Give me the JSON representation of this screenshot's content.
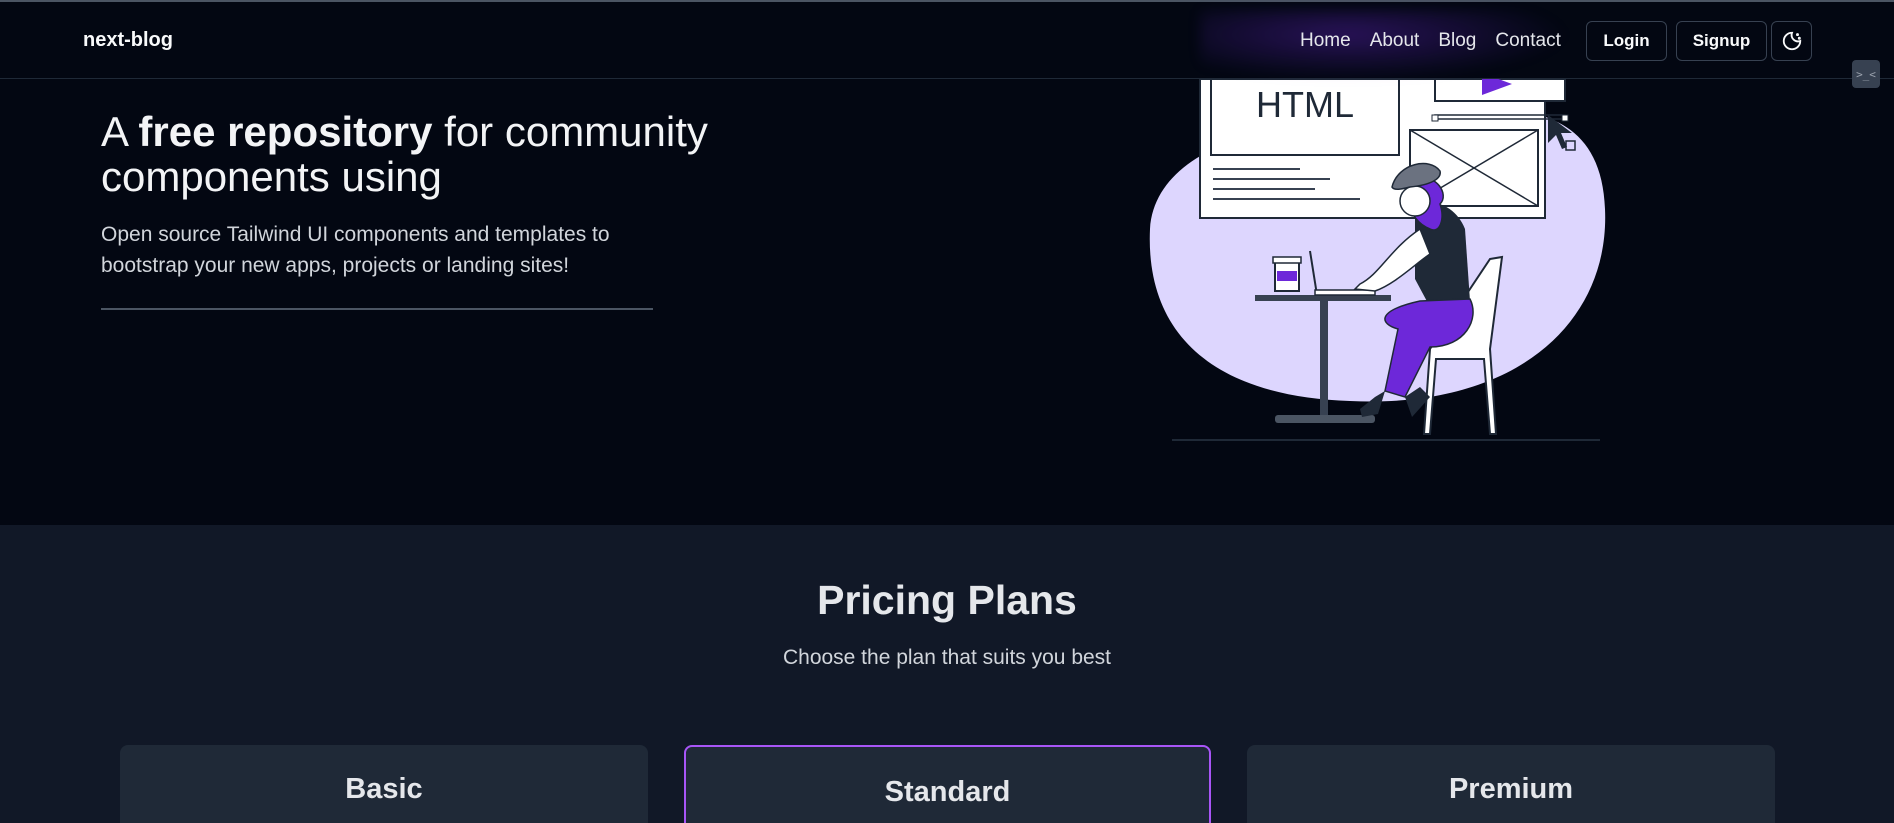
{
  "header": {
    "brand": "next-blog",
    "nav": [
      "Home",
      "About",
      "Blog",
      "Contact"
    ],
    "login_label": "Login",
    "signup_label": "Signup",
    "theme_toggle_icon": "moon-icon"
  },
  "hero": {
    "title_pre": "A ",
    "title_bold": "free repository",
    "title_post": " for community components using",
    "description": "Open source Tailwind UI components and templates to bootstrap your new apps, projects or landing sites!",
    "illustration_text": "HTML"
  },
  "pricing": {
    "title": "Pricing Plans",
    "subtitle": "Choose the plan that suits you best",
    "plans": [
      "Basic",
      "Standard",
      "Premium"
    ]
  },
  "colors": {
    "background": "#030712",
    "section": "#111827",
    "card": "#1f2937",
    "accent": "#a855f7",
    "illustration_purple": "#6d28d9",
    "illustration_blob": "#ddd6fe"
  }
}
